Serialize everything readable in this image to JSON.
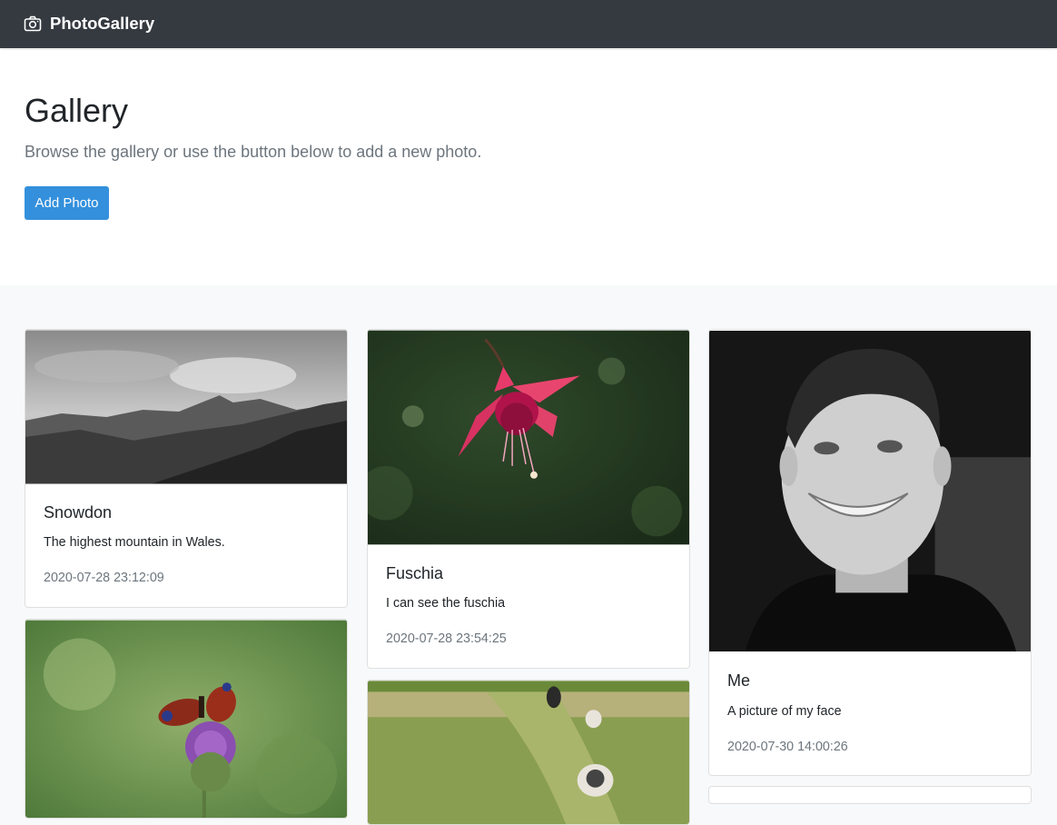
{
  "navbar": {
    "brand": "PhotoGallery",
    "brand_icon": "camera-icon"
  },
  "header": {
    "title": "Gallery",
    "lead": "Browse the gallery or use the button below to add a new photo.",
    "add_button": "Add Photo"
  },
  "photos": [
    {
      "title": "Snowdon",
      "description": "The highest mountain in Wales.",
      "date": "2020-07-28 23:12:09",
      "image": "mountain landscape"
    },
    {
      "title": "Fuschia",
      "description": "I can see the fuschia",
      "date": "2020-07-28 23:54:25",
      "image": "fuchsia flower"
    },
    {
      "title": "Me",
      "description": "A picture of my face",
      "date": "2020-07-30 14:00:26",
      "image": "portrait"
    },
    {
      "image": "butterfly on thistle"
    },
    {
      "image": "dogs in field"
    }
  ],
  "colors": {
    "navbar": "#343a40",
    "accent": "#3490dc",
    "muted": "#6c757d",
    "section_bg": "#f8f9fa"
  }
}
